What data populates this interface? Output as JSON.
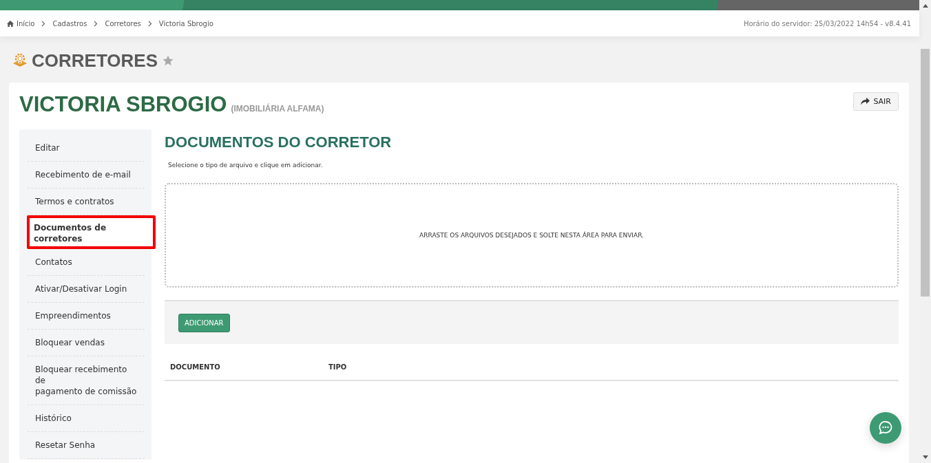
{
  "breadcrumb": [
    {
      "label": "Início",
      "kind": "home"
    },
    {
      "label": "Cadastros",
      "kind": "link"
    },
    {
      "label": "Corretores",
      "kind": "link"
    },
    {
      "label": "Victoria Sbrogio",
      "kind": "link"
    }
  ],
  "server_info": "Horário do servidor: 25/03/2022 14h54 - v8.4.41",
  "page_title": "CORRETORES",
  "favorite": false,
  "person": {
    "name": "VICTORIA SBROGIO",
    "company": "(IMOBILIÁRIA ALFAMA)"
  },
  "exit_button": "SAIR",
  "sidebar": {
    "items": [
      {
        "label": "Editar",
        "selected": false
      },
      {
        "label": "Recebimento de e-mail",
        "selected": false
      },
      {
        "label": "Termos e contratos",
        "selected": false
      },
      {
        "label": "Documentos de corretores",
        "selected": true
      },
      {
        "label": "Contatos",
        "selected": false
      },
      {
        "label": "Ativar/Desativar Login",
        "selected": false
      },
      {
        "label": "Empreendimentos",
        "selected": false
      },
      {
        "label": "Bloquear vendas",
        "selected": false
      },
      {
        "label": "Bloquear recebimento de\npagamento de comissão",
        "selected": false
      },
      {
        "label": "Histórico",
        "selected": false
      },
      {
        "label": "Resetar Senha",
        "selected": false
      }
    ]
  },
  "section_title": "DOCUMENTOS DO CORRETOR",
  "instructions": "Selecione o tipo de arquivo e clique em adicionar.",
  "dropzone_text": "ARRASTE OS ARQUIVOS DESEJADOS E SOLTE NESTA ÁREA PARA ENVIAR.",
  "add_button": "ADICIONAR",
  "table": {
    "columns": [
      "DOCUMENTO",
      "TIPO"
    ]
  }
}
